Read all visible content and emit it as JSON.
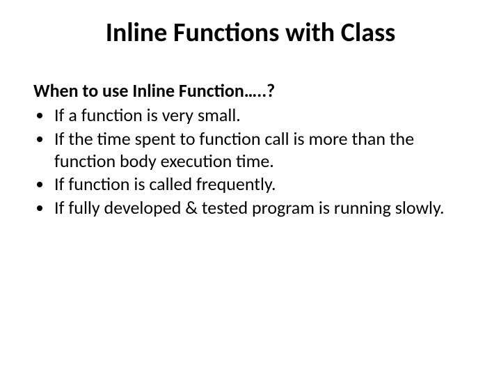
{
  "title": "Inline Functions with Class",
  "subheading": "When to use Inline Function…..?",
  "bullets": [
    "If a function is very small.",
    "If the time spent to function call is more than the function body execution time.",
    "If function is called frequently.",
    "If fully developed & tested program is running slowly."
  ]
}
